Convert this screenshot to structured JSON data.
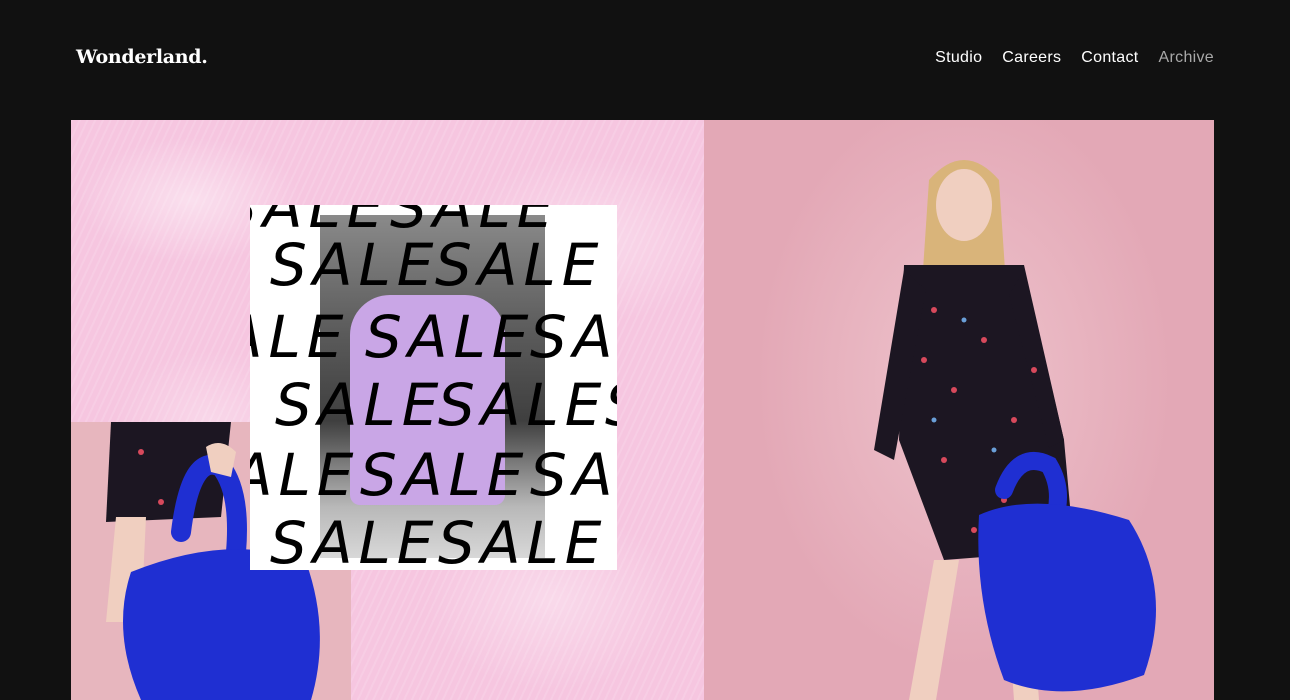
{
  "header": {
    "logo": "Wonderland.",
    "nav": [
      {
        "label": "Studio"
      },
      {
        "label": "Careers"
      },
      {
        "label": "Contact"
      },
      {
        "label": "Archive"
      }
    ]
  },
  "hero": {
    "sale_word": "SALE",
    "colors": {
      "fur_pink": "#f6c6e0",
      "backdrop_pink": "#e7b6be",
      "bag_blue": "#1f2fd2",
      "jacket_lilac": "#c9a6e6",
      "page_bg": "#111111"
    }
  }
}
